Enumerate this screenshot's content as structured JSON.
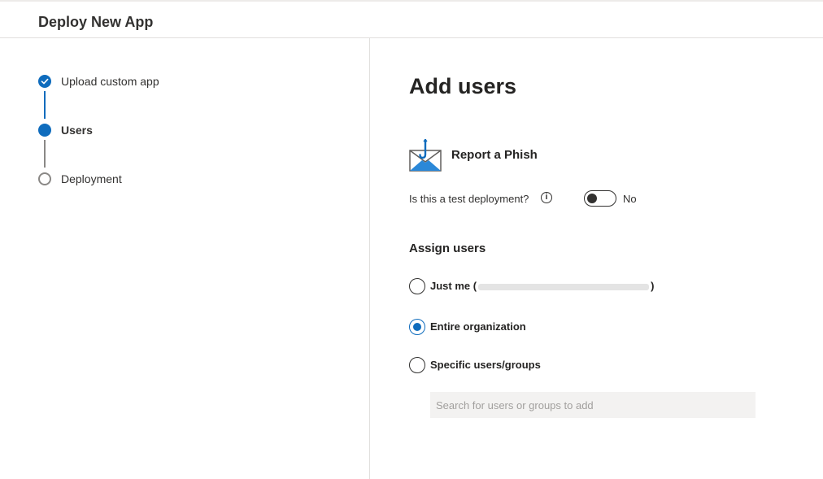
{
  "header": {
    "title": "Deploy New App"
  },
  "steps": [
    {
      "label": "Upload custom app",
      "state": "done"
    },
    {
      "label": "Users",
      "state": "current"
    },
    {
      "label": "Deployment",
      "state": "todo"
    }
  ],
  "main": {
    "title": "Add users",
    "app": {
      "name": "Report a Phish",
      "icon": "report-phish-envelope-icon"
    },
    "test_deployment": {
      "label": "Is this a test deployment?",
      "value": "No",
      "enabled": false
    }
  },
  "assign": {
    "title": "Assign users",
    "options": [
      {
        "prefix": "Just me (",
        "suffix": ")",
        "selected": false
      },
      {
        "label": "Entire organization",
        "selected": true
      },
      {
        "label": "Specific users/groups",
        "selected": false
      }
    ],
    "search_placeholder": "Search for users or groups to add"
  },
  "colors": {
    "accent": "#0f6cbd",
    "border": "#e1dfdd",
    "input_bg": "#f3f2f1"
  }
}
